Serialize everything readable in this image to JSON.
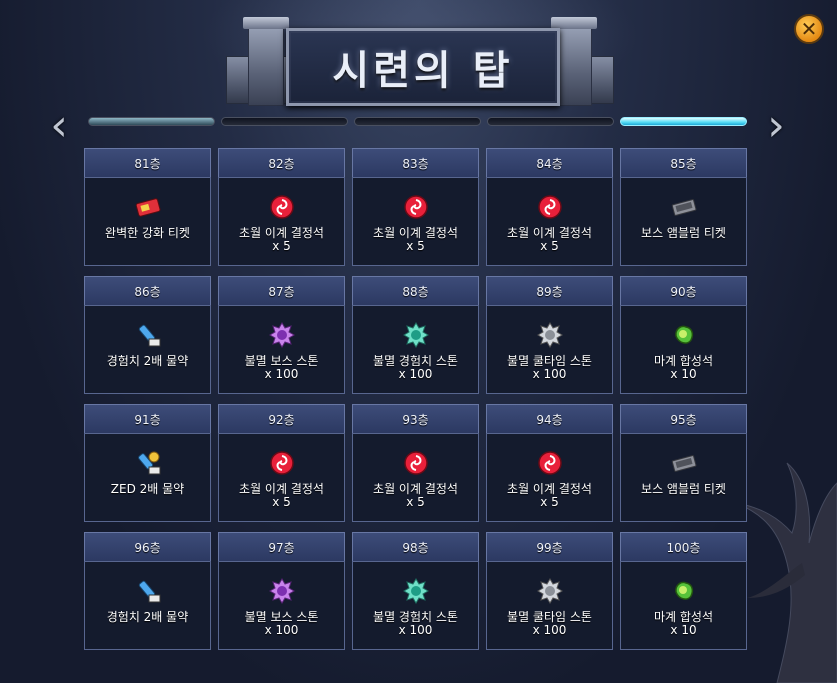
{
  "title": "시련의 탑",
  "close_label": "✕",
  "nav": {
    "prev": "‹",
    "next": "›"
  },
  "pages": [
    {
      "state": "first"
    },
    {
      "state": "normal"
    },
    {
      "state": "normal"
    },
    {
      "state": "normal"
    },
    {
      "state": "active"
    }
  ],
  "floors": [
    {
      "floor": "81층",
      "item": "완벽한 강화 티켓",
      "qty": "",
      "icon": "enhance-ticket-icon"
    },
    {
      "floor": "82층",
      "item": "초월 이계 결정석",
      "qty": "x 5",
      "icon": "red-crystal-icon"
    },
    {
      "floor": "83층",
      "item": "초월 이계 결정석",
      "qty": "x 5",
      "icon": "red-crystal-icon"
    },
    {
      "floor": "84층",
      "item": "초월 이계 결정석",
      "qty": "x 5",
      "icon": "red-crystal-icon"
    },
    {
      "floor": "85층",
      "item": "보스 앰블럼 티켓",
      "qty": "",
      "icon": "boss-ticket-icon"
    },
    {
      "floor": "86층",
      "item": "경험치 2배 물약",
      "qty": "",
      "icon": "exp-potion-icon"
    },
    {
      "floor": "87층",
      "item": "불멸 보스 스톤",
      "qty": "x 100",
      "icon": "purple-stone-icon"
    },
    {
      "floor": "88층",
      "item": "불멸 경험치 스톤",
      "qty": "x 100",
      "icon": "teal-stone-icon"
    },
    {
      "floor": "89층",
      "item": "불멸 쿨타임 스톤",
      "qty": "x 100",
      "icon": "silver-stone-icon"
    },
    {
      "floor": "90층",
      "item": "마계 합성석",
      "qty": "x 10",
      "icon": "green-stone-icon"
    },
    {
      "floor": "91층",
      "item": "ZED 2배 물약",
      "qty": "",
      "icon": "zed-potion-icon"
    },
    {
      "floor": "92층",
      "item": "초월 이계 결정석",
      "qty": "x 5",
      "icon": "red-crystal-icon"
    },
    {
      "floor": "93층",
      "item": "초월 이계 결정석",
      "qty": "x 5",
      "icon": "red-crystal-icon"
    },
    {
      "floor": "94층",
      "item": "초월 이계 결정석",
      "qty": "x 5",
      "icon": "red-crystal-icon"
    },
    {
      "floor": "95층",
      "item": "보스 앰블럼 티켓",
      "qty": "",
      "icon": "boss-ticket-icon"
    },
    {
      "floor": "96층",
      "item": "경험치 2배 물약",
      "qty": "",
      "icon": "exp-potion-icon"
    },
    {
      "floor": "97층",
      "item": "불멸 보스 스톤",
      "qty": "x 100",
      "icon": "purple-stone-icon"
    },
    {
      "floor": "98층",
      "item": "불멸 경험치 스톤",
      "qty": "x 100",
      "icon": "teal-stone-icon"
    },
    {
      "floor": "99층",
      "item": "불멸 쿨타임 스톤",
      "qty": "x 100",
      "icon": "silver-stone-icon"
    },
    {
      "floor": "100층",
      "item": "마계 합성석",
      "qty": "x 10",
      "icon": "green-stone-icon"
    }
  ],
  "colors": {
    "accent": "#55dcf5",
    "header": "#34416c",
    "cell_bg": "#141b2d",
    "close": "#e48a14"
  }
}
